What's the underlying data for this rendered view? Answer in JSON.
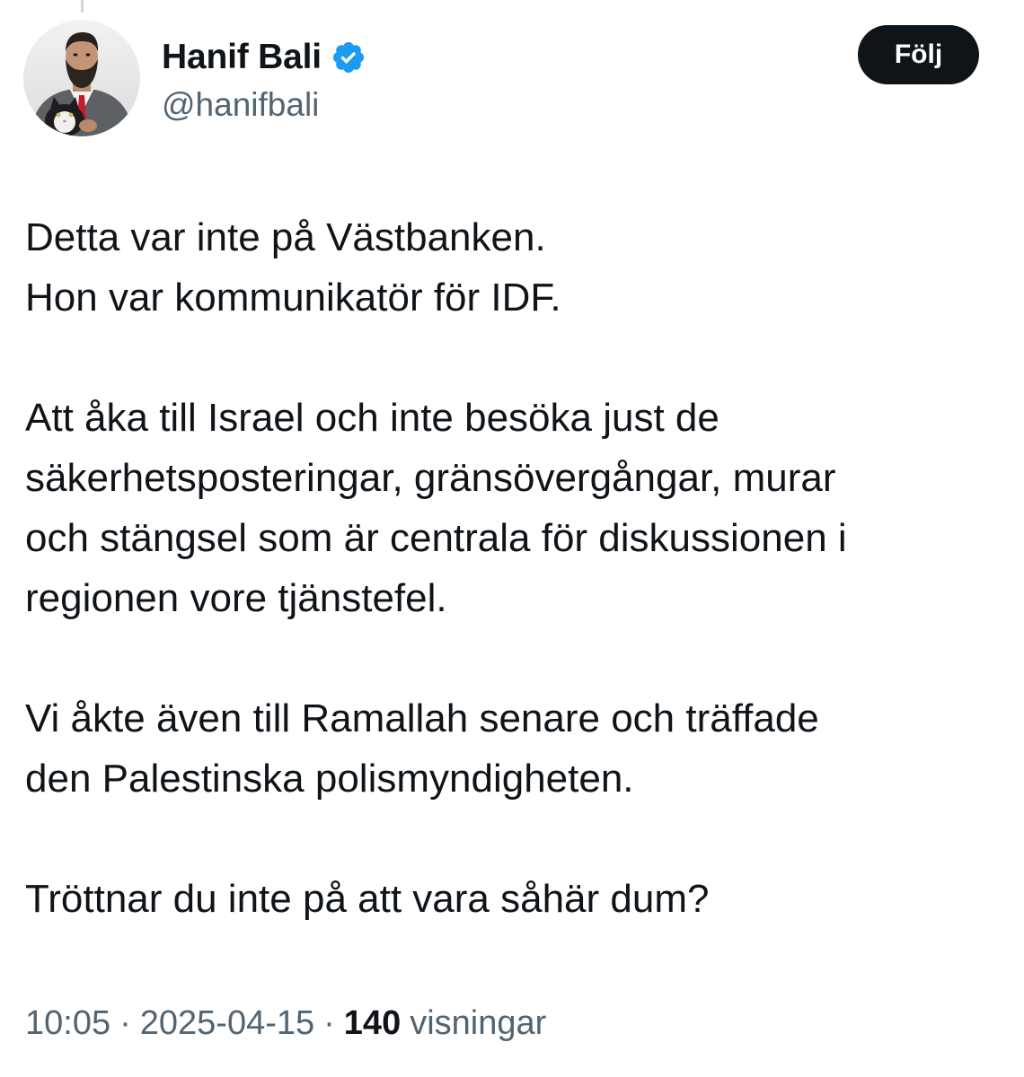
{
  "author": {
    "display_name": "Hanif Bali",
    "handle": "@hanifbali",
    "verified": true,
    "verified_color": "#1d9bf0"
  },
  "follow_button": {
    "label": "Följ"
  },
  "tweet": {
    "paragraphs": [
      {
        "lines": [
          "Detta var inte på Västbanken.",
          "Hon var kommunikatör för IDF."
        ]
      },
      {
        "lines": [
          "Att åka till Israel och inte besöka just de",
          "säkerhetsposteringar, gränsövergångar, murar",
          "och stängsel som är centrala för diskussionen i",
          "regionen vore tjänstefel."
        ]
      },
      {
        "lines": [
          "Vi åkte även till Ramallah senare och träffade",
          "den Palestinska polismyndigheten."
        ]
      },
      {
        "lines": [
          "Tröttnar du inte på att vara såhär dum?"
        ]
      }
    ]
  },
  "meta": {
    "time": "10:05",
    "separator": "·",
    "date": "2025-04-15",
    "views_count": "140",
    "views_label": "visningar"
  },
  "colors": {
    "text_primary": "#0f1419",
    "text_secondary": "#536471",
    "button_bg": "#0f1419",
    "verified": "#1d9bf0"
  }
}
